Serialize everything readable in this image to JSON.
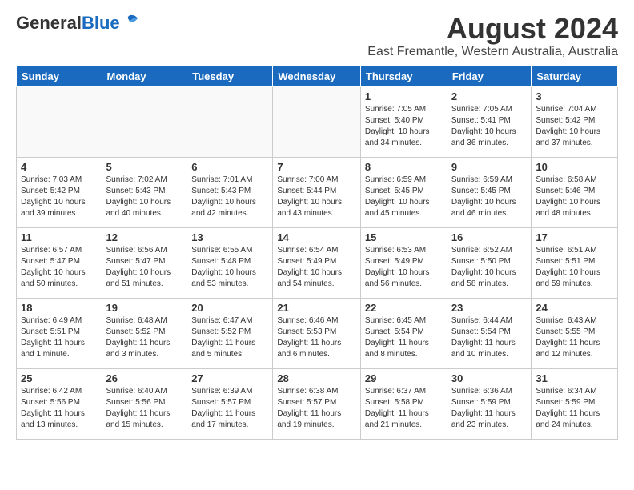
{
  "header": {
    "logo_general": "General",
    "logo_blue": "Blue",
    "title": "August 2024",
    "subtitle": "East Fremantle, Western Australia, Australia"
  },
  "calendar": {
    "days_of_week": [
      "Sunday",
      "Monday",
      "Tuesday",
      "Wednesday",
      "Thursday",
      "Friday",
      "Saturday"
    ],
    "weeks": [
      [
        {
          "day": "",
          "info": ""
        },
        {
          "day": "",
          "info": ""
        },
        {
          "day": "",
          "info": ""
        },
        {
          "day": "",
          "info": ""
        },
        {
          "day": "1",
          "info": "Sunrise: 7:05 AM\nSunset: 5:40 PM\nDaylight: 10 hours\nand 34 minutes."
        },
        {
          "day": "2",
          "info": "Sunrise: 7:05 AM\nSunset: 5:41 PM\nDaylight: 10 hours\nand 36 minutes."
        },
        {
          "day": "3",
          "info": "Sunrise: 7:04 AM\nSunset: 5:42 PM\nDaylight: 10 hours\nand 37 minutes."
        }
      ],
      [
        {
          "day": "4",
          "info": "Sunrise: 7:03 AM\nSunset: 5:42 PM\nDaylight: 10 hours\nand 39 minutes."
        },
        {
          "day": "5",
          "info": "Sunrise: 7:02 AM\nSunset: 5:43 PM\nDaylight: 10 hours\nand 40 minutes."
        },
        {
          "day": "6",
          "info": "Sunrise: 7:01 AM\nSunset: 5:43 PM\nDaylight: 10 hours\nand 42 minutes."
        },
        {
          "day": "7",
          "info": "Sunrise: 7:00 AM\nSunset: 5:44 PM\nDaylight: 10 hours\nand 43 minutes."
        },
        {
          "day": "8",
          "info": "Sunrise: 6:59 AM\nSunset: 5:45 PM\nDaylight: 10 hours\nand 45 minutes."
        },
        {
          "day": "9",
          "info": "Sunrise: 6:59 AM\nSunset: 5:45 PM\nDaylight: 10 hours\nand 46 minutes."
        },
        {
          "day": "10",
          "info": "Sunrise: 6:58 AM\nSunset: 5:46 PM\nDaylight: 10 hours\nand 48 minutes."
        }
      ],
      [
        {
          "day": "11",
          "info": "Sunrise: 6:57 AM\nSunset: 5:47 PM\nDaylight: 10 hours\nand 50 minutes."
        },
        {
          "day": "12",
          "info": "Sunrise: 6:56 AM\nSunset: 5:47 PM\nDaylight: 10 hours\nand 51 minutes."
        },
        {
          "day": "13",
          "info": "Sunrise: 6:55 AM\nSunset: 5:48 PM\nDaylight: 10 hours\nand 53 minutes."
        },
        {
          "day": "14",
          "info": "Sunrise: 6:54 AM\nSunset: 5:49 PM\nDaylight: 10 hours\nand 54 minutes."
        },
        {
          "day": "15",
          "info": "Sunrise: 6:53 AM\nSunset: 5:49 PM\nDaylight: 10 hours\nand 56 minutes."
        },
        {
          "day": "16",
          "info": "Sunrise: 6:52 AM\nSunset: 5:50 PM\nDaylight: 10 hours\nand 58 minutes."
        },
        {
          "day": "17",
          "info": "Sunrise: 6:51 AM\nSunset: 5:51 PM\nDaylight: 10 hours\nand 59 minutes."
        }
      ],
      [
        {
          "day": "18",
          "info": "Sunrise: 6:49 AM\nSunset: 5:51 PM\nDaylight: 11 hours\nand 1 minute."
        },
        {
          "day": "19",
          "info": "Sunrise: 6:48 AM\nSunset: 5:52 PM\nDaylight: 11 hours\nand 3 minutes."
        },
        {
          "day": "20",
          "info": "Sunrise: 6:47 AM\nSunset: 5:52 PM\nDaylight: 11 hours\nand 5 minutes."
        },
        {
          "day": "21",
          "info": "Sunrise: 6:46 AM\nSunset: 5:53 PM\nDaylight: 11 hours\nand 6 minutes."
        },
        {
          "day": "22",
          "info": "Sunrise: 6:45 AM\nSunset: 5:54 PM\nDaylight: 11 hours\nand 8 minutes."
        },
        {
          "day": "23",
          "info": "Sunrise: 6:44 AM\nSunset: 5:54 PM\nDaylight: 11 hours\nand 10 minutes."
        },
        {
          "day": "24",
          "info": "Sunrise: 6:43 AM\nSunset: 5:55 PM\nDaylight: 11 hours\nand 12 minutes."
        }
      ],
      [
        {
          "day": "25",
          "info": "Sunrise: 6:42 AM\nSunset: 5:56 PM\nDaylight: 11 hours\nand 13 minutes."
        },
        {
          "day": "26",
          "info": "Sunrise: 6:40 AM\nSunset: 5:56 PM\nDaylight: 11 hours\nand 15 minutes."
        },
        {
          "day": "27",
          "info": "Sunrise: 6:39 AM\nSunset: 5:57 PM\nDaylight: 11 hours\nand 17 minutes."
        },
        {
          "day": "28",
          "info": "Sunrise: 6:38 AM\nSunset: 5:57 PM\nDaylight: 11 hours\nand 19 minutes."
        },
        {
          "day": "29",
          "info": "Sunrise: 6:37 AM\nSunset: 5:58 PM\nDaylight: 11 hours\nand 21 minutes."
        },
        {
          "day": "30",
          "info": "Sunrise: 6:36 AM\nSunset: 5:59 PM\nDaylight: 11 hours\nand 23 minutes."
        },
        {
          "day": "31",
          "info": "Sunrise: 6:34 AM\nSunset: 5:59 PM\nDaylight: 11 hours\nand 24 minutes."
        }
      ]
    ]
  }
}
